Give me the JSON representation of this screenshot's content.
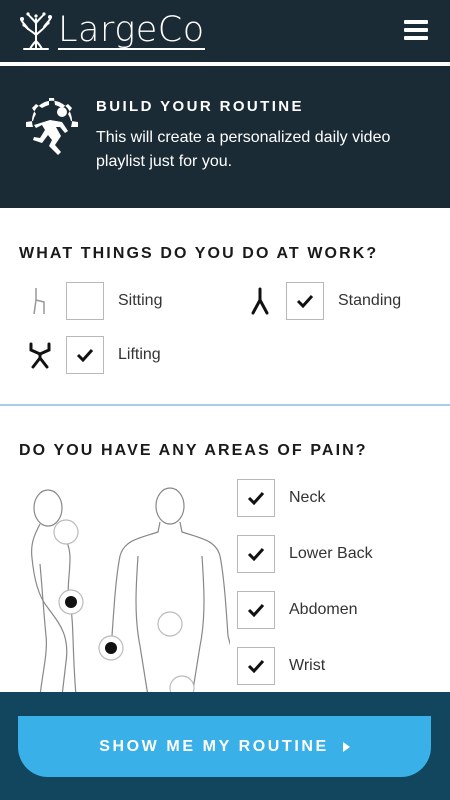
{
  "header": {
    "logo_text": "LargeCo",
    "logo_icon": "tree-icon",
    "menu_icon": "hamburger-menu-icon"
  },
  "hero": {
    "icon": "gear-runner-icon",
    "title": "BUILD YOUR ROUTINE",
    "subtitle": "This will create a personalized daily video playlist just for you."
  },
  "work": {
    "title": "WHAT THINGS DO YOU DO AT WORK?",
    "options": [
      {
        "label": "Sitting",
        "checked": false,
        "icon": "sitting-icon"
      },
      {
        "label": "Standing",
        "checked": true,
        "icon": "standing-icon"
      },
      {
        "label": "Lifting",
        "checked": true,
        "icon": "lifting-icon"
      }
    ]
  },
  "pain": {
    "title": "DO YOU HAVE ANY AREAS OF PAIN?",
    "options": [
      {
        "label": "Neck",
        "checked": true
      },
      {
        "label": "Lower Back",
        "checked": true
      },
      {
        "label": "Abdomen",
        "checked": true
      },
      {
        "label": "Wrist",
        "checked": true
      }
    ],
    "figure_icon": "body-diagram-icon"
  },
  "cta": {
    "label": "SHOW ME MY ROUTINE",
    "icon": "play-arrow-icon"
  },
  "colors": {
    "header_bg": "#1b2b35",
    "footer_bg": "#12465e",
    "accent": "#3ab0e8",
    "divider": "#a9cfe6"
  }
}
